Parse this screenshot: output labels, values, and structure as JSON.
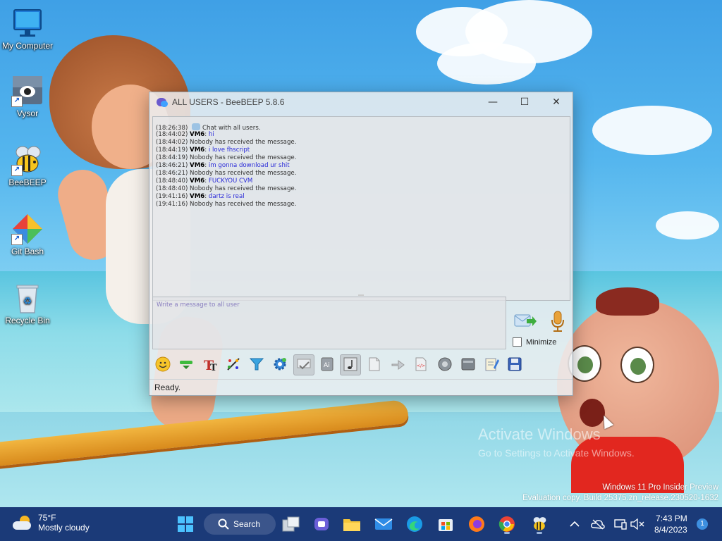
{
  "desktop": {
    "icons": [
      {
        "label": "My Computer"
      },
      {
        "label": "Vysor"
      },
      {
        "label": "BeeBEEP"
      },
      {
        "label": "Git Bash"
      },
      {
        "label": "Recycle Bin"
      }
    ],
    "watermark": {
      "line1": "Activate Windows",
      "line2": "Go to Settings to Activate Windows."
    },
    "evaluation": {
      "line1": "Windows 11 Pro Insider Preview",
      "line2": "Evaluation copy. Build 25375.zn_release.230520-1632"
    }
  },
  "window": {
    "title": "ALL USERS - BeeBEEP 5.8.6",
    "controls": {
      "minimize": "—",
      "maximize": "☐",
      "close": "✕"
    },
    "chat": [
      {
        "ts": "(18:26:38)",
        "system": true,
        "text": "Chat with all users."
      },
      {
        "ts": "(18:44:02)",
        "user": "VM6",
        "text": "hi"
      },
      {
        "ts": "(18:44:02)",
        "system": true,
        "text": "Nobody has received the message."
      },
      {
        "ts": "(18:44:19)",
        "user": "VM6",
        "text": "i love fhscript"
      },
      {
        "ts": "(18:44:19)",
        "system": true,
        "text": "Nobody has received the message."
      },
      {
        "ts": "(18:46:21)",
        "user": "VM6",
        "text": "im gonna download ur shit"
      },
      {
        "ts": "(18:46:21)",
        "system": true,
        "text": "Nobody has received the message."
      },
      {
        "ts": "(18:48:40)",
        "user": "VM6",
        "text": "FUCKYOU CVM"
      },
      {
        "ts": "(18:48:40)",
        "system": true,
        "text": "Nobody has received the message."
      },
      {
        "ts": "(19:41:16)",
        "user": "VM6",
        "text": "dartz is real"
      },
      {
        "ts": "(19:41:16)",
        "system": true,
        "text": "Nobody has received the message."
      }
    ],
    "input_placeholder": "Write a message to all user",
    "minimize_label": "Minimize",
    "minimize_checked": false,
    "toolbar": [
      {
        "name": "emoticons-icon"
      },
      {
        "name": "minimize-panel-icon"
      },
      {
        "name": "font-icon"
      },
      {
        "name": "font-color-icon"
      },
      {
        "name": "filter-icon"
      },
      {
        "name": "settings-icon"
      },
      {
        "name": "spellcheck-icon",
        "pressed": true
      },
      {
        "name": "completer-icon"
      },
      {
        "name": "music-note-icon",
        "pressed": true
      },
      {
        "name": "send-file-icon"
      },
      {
        "name": "send-folder-icon"
      },
      {
        "name": "html-source-icon"
      },
      {
        "name": "screenshot-icon"
      },
      {
        "name": "clear-chat-icon"
      },
      {
        "name": "edit-notes-icon"
      },
      {
        "name": "save-chat-icon"
      }
    ],
    "status": "Ready."
  },
  "taskbar": {
    "weather": {
      "temp": "75°F",
      "condition": "Mostly cloudy"
    },
    "search_label": "Search",
    "clock": {
      "time": "7:43 PM",
      "date": "8/4/2023"
    },
    "notifications": "1",
    "colors": {
      "taskbar_bg": "#1b3a78",
      "accent": "#3d8fe0"
    }
  }
}
